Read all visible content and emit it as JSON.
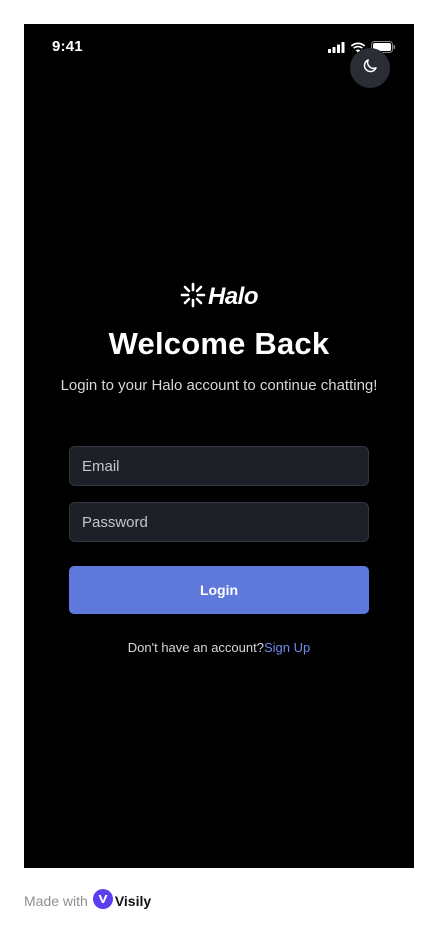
{
  "status_bar": {
    "time": "9:41"
  },
  "icons": {
    "theme_toggle": "moon-icon",
    "signal": "cellular-signal-icon",
    "wifi": "wifi-icon",
    "battery": "battery-icon",
    "logo": "halo-burst-icon",
    "visily": "visily-logo-icon"
  },
  "brand": {
    "logo_text": "Halo"
  },
  "login": {
    "title": "Welcome Back",
    "subtitle": "Login to your Halo account to continue chatting!",
    "email_placeholder": "Email",
    "password_placeholder": "Password",
    "button_label": "Login",
    "signup_prompt": "Don't have an account?",
    "signup_link": "Sign Up"
  },
  "footer": {
    "made_with": "Made with",
    "brand": "Visily"
  },
  "colors": {
    "background": "#000000",
    "input_background": "#1d2027",
    "primary_button": "#5e78dc",
    "link": "#6f8bea",
    "toggle_background": "#2a2d34",
    "visily_purple": "#5a3ff0"
  }
}
